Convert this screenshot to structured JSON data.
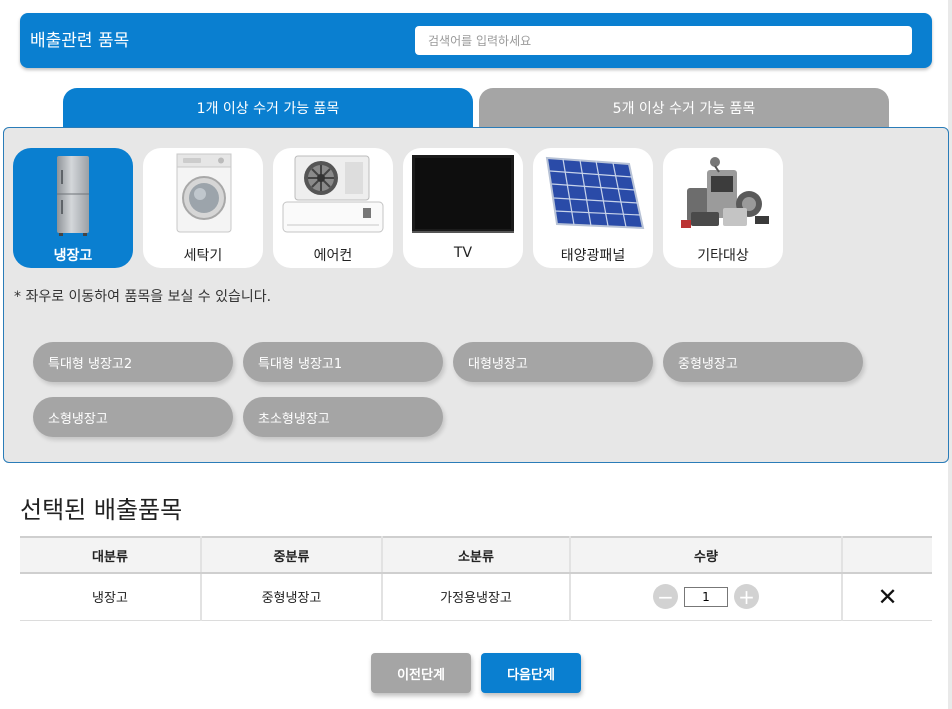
{
  "header": {
    "title": "배출관련 품목",
    "search_placeholder": "검색어를 입력하세요"
  },
  "tabs": [
    {
      "label": "1개 이상 수거 가능 품목",
      "active": true
    },
    {
      "label": "5개 이상 수거 가능 품목",
      "active": false
    }
  ],
  "categories": [
    {
      "label": "냉장고",
      "icon": "refrigerator-icon",
      "selected": true
    },
    {
      "label": "세탁기",
      "icon": "washing-machine-icon",
      "selected": false
    },
    {
      "label": "에어컨",
      "icon": "air-conditioner-icon",
      "selected": false
    },
    {
      "label": "TV",
      "icon": "tv-icon",
      "selected": false
    },
    {
      "label": "태양광패널",
      "icon": "solar-panel-icon",
      "selected": false
    },
    {
      "label": "기타대상",
      "icon": "misc-appliances-icon",
      "selected": false
    }
  ],
  "hint": "* 좌우로 이동하여 품목을 보실 수 있습니다.",
  "subcategories": [
    "특대형 냉장고2",
    "특대형 냉장고1",
    "대형냉장고",
    "중형냉장고",
    "소형냉장고",
    "초소형냉장고"
  ],
  "selected_section": {
    "title": "선택된 배출품목",
    "columns": [
      "대분류",
      "중분류",
      "소분류",
      "수량",
      ""
    ],
    "rows": [
      {
        "major": "냉장고",
        "middle": "중형냉장고",
        "minor": "가정용냉장고",
        "quantity": "1"
      }
    ],
    "minus": "−",
    "plus": "+",
    "remove": "✕"
  },
  "buttons": {
    "prev": "이전단계",
    "next": "다음단계"
  },
  "colors": {
    "accent": "#0a7fd0",
    "inactive": "#a5a5a5",
    "panel_bg": "#e7e7e7"
  }
}
